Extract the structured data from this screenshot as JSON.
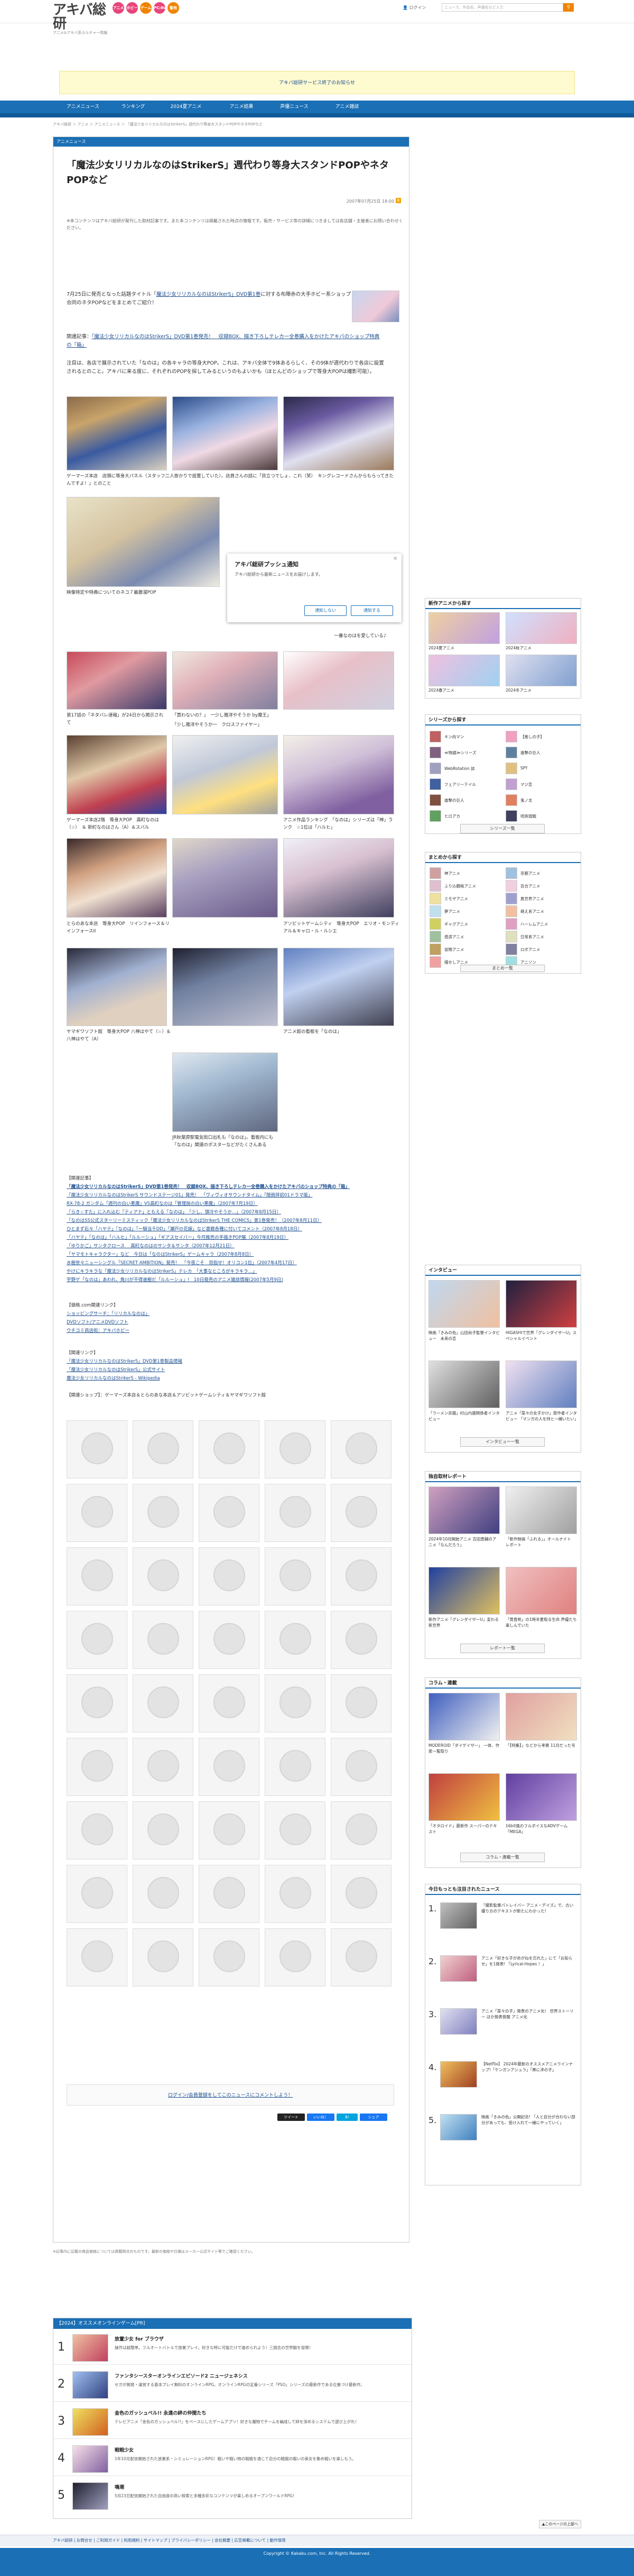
{
  "site": {
    "logo_main": "アキバ総研",
    "logo_sub": "アニメ&アキバ系カルチャー情報",
    "login": "ログイン",
    "search_placeholder": "ニュース、作品名、声優名など入力",
    "search_btn": "🔍"
  },
  "cats": [
    {
      "label": "アニメ",
      "color": "#e8457b"
    },
    {
      "label": "ホビー",
      "color": "#e8457b"
    },
    {
      "label": "ゲーム",
      "color": "#f08300"
    },
    {
      "label": "PC/AV",
      "color": "#e8457b"
    },
    {
      "label": "聖地",
      "color": "#f08300"
    }
  ],
  "notice": "アキバ総研サービス終了のお知らせ",
  "nav": [
    "アニメニュース",
    "ランキング",
    "2024夏アニメ",
    "アニメ結果",
    "声優ニュース",
    "アニメ雑誌"
  ],
  "breadcrumb": "アキバ総研 ＞ アニメ ＞ アニメニュース ＞ 「魔法少女リリカルなのはStrikerS」週代わり等身大スタンドPOPやネタPOPなど",
  "main": {
    "section": "アニメニュース",
    "title": "「魔法少女リリカルなのはStrikerS」週代わり等身大スタンドPOPやネタPOPなど",
    "date": "2007年07月25日 18:00",
    "share": "B",
    "disclaimer": "※本コンテンツはアキバ総研が発刊した取材記事です。また本コンテンツは掲載された時点の情報です。販売・サービス等の詳細につきましては各店舗・主催者にお問い合わせください。",
    "p1a": "7月25日に発売となった話題タイトル「",
    "p1link": "魔法少女リリカルなのはStrikerS」DVD第1巻",
    "p1b": "に対する布陣赤の大手ホビー系ショップ合同のネタPOPなどをまとめてご紹介！",
    "p2a": "関連記事：",
    "p2link": "「魔法少女リリカルなのはStrikerS」DVD第1巻発売！　収録BOX、描き下ろしテレカ一全巻購入をかけたアキバのショップ特典の「箱」",
    "p3": "注目は、各店で展示されていた「なのは」の各キャラの等身大POP。これは、アキバ全体で9体あるらしく、その9体が週代わりで各店に設置されるとのこと。アキバに来る度に、それぞれのPOPを探してみるというのもよいかも（ほとんどのショップで等身大POPは撮影可能）。",
    "cap1": "ゲーマーズ本店　店頭に等身大パネル（スタッフ二人掛かりで設置していた）。店員さんの話に「目立つでしょ、これ（笑）　キングレコードさんからもらってきたんですよ！」とのこと",
    "cap2": "映像特定や特典についてのネコ７最藤溜POP",
    "cap3": "一番なのはを愛している♪",
    "cap4": "第17話の「ネタバレ速報」が24日から掲示されて",
    "cap5": "「買わないの？」　一少し雅洋やそうか by魔王」",
    "cap6": "「少し雅洋やそうか一　クロスファイヤー」",
    "cap7": "ゲーマーズ本店2階　等身大POP　高町なのは（☆）　＆ 新町なのはさん（A）＆スバル",
    "cap8": "アニメ作品ランキング　「なのは」シリーズは「神」ランク　☆1位は「ハルヒ」",
    "cap9": "とらのあな本店　等身大POP　リインフォース＆リインフォースII",
    "cap10": "アソビットゲームシティ　等身大POP　エリオ・モンディアル＆キャロ・ル・ルシエ",
    "cap11": "ヤマギワソフト館　等身大POP 八神はやて（☆）＆八神はやて（A）",
    "cap12": "アニメ館の看板を「なのは」",
    "cap13": "JR秋葉原駅電気街口出札も「なのは」。看板内にも「なのは」関連のポスターなどがたくさんある",
    "popup_title": "アキバ総研プッシュ通知",
    "popup_body": "アキバ総研から最新ニュースをお届けします。",
    "popup_no": "通知しない",
    "popup_yes": "通知する",
    "rel_head": "【関連記事】",
    "rel_links": [
      "「魔法少女リリカルなのはStrikerS」DVD第1巻発売！　収録BOX、描き下ろしテレカ一全巻購入をかけたアキバのショップ特典の「箱」",
      "「魔法少女リリカルなのはStrikerS サウンドステージ01」発売！　「ヴィヴィオサウンドタイム」「隠雨拝初01ドラマ版」",
      "RX-78-2 ガンダム「週刊の白い悪魔」VS高町なのは「管理局の白い悪魔」（2007年7月19日）",
      "「らき☆すた」に入れ込む「ティアナ」ともえる「なのは」　「少し、頭冷やそうか…」（2007年8月15日）",
      "「なのはSS公式スターリーミスティック「魔法少女リリカルなのはStrikerS THE COMICS」第1巻発売！（2007年8月11日）",
      "ひとまず石々「ハヤテ」「なのは」「一騎当千DD」「瀬戸の花嫁」など書籍各種に付いてコメント（2007年8月18日）",
      "「ハヤテ」「なのは」「ハルヒ」「ルルーシュ」「ギアスセイバー」今月推売の手描きPOP展（2007年8月19日）",
      "「ゆりかご」サンタクロース 　高町なのはのサンタ＆サンタ（2007年12月21日）",
      "「ヤマモトキャラクター」など　今日は「なのはStrikerS」ゲームキャラ（2007年8月8日）",
      "水樹奈々ニューシングル「SECRET AMBITION」発売！　「今夜こそ　目指せ！オリコン1位」（2007年4月17日）",
      "やけにキラキラな「魔法少女リリカルなのはStrikerS」テレカ　「大事なところがキラキラ…」",
      "宇野ゲ「なのは」あわれ、角川が不得道樹だ「ルルーシュ」!　10日発売のアニメ雑誌情報(2007年5月9日)"
    ],
    "ecom_head": "【価格.com関連リンク】",
    "ecom_links": [
      "ショッピングサーチ：「リリカルなのは」",
      "DVDソフト/アニメDVDソフト",
      "ウチコミ商店街：アキバホビー"
    ],
    "link_head": "【関連リンク】",
    "links": [
      "「魔法少女リリカルなのはStrikerS」DVD第1巻製品情報",
      "「魔法少女リリカルなのはStrikerS」公式サイト",
      "魔法少女リリカルなのはStrikerS - Wikipedia"
    ],
    "shop_line": "【関連ショップ】：ゲーマーズ本店＆とらのあな本店＆アソビットゲームシティ＆ヤマギワソフト館",
    "comment_link": "ログイン/会員登録をしてこのニュースにコメントしよう！",
    "share_btns": [
      "ツイート",
      "いいね！",
      "B!",
      "シェア"
    ],
    "footer_note": "※記事内に記載の商品価格については掲載時点のものです。最新の価格や仕様はメーカー公式サイト等でご確認ください。"
  },
  "ranking": {
    "header": "【2024】オススメオンラインゲーム[PR]",
    "items": [
      {
        "title": "放置少女 for ブラウザ",
        "desc": "操作は超簡単。フルオートバトルで放置プレイ。好きな時に可能だけで進められよう！三国志の世界観を冒険！"
      },
      {
        "title": "ファンタシースターオンラインエピソード2 ニュージェネシス",
        "desc": "セガが開発・運営する基本プレイ無料のオンラインRPG。オンラインRPGの定番シリーズ「PSO」シリーズの最新作である位置づけ最新作。"
      },
      {
        "title": "金色のガッシュベル!! 永遠の絆の仲間たち",
        "desc": "テレビアニメ「金色のガッシュベル!!」をベースにしたゲームアプリ！好きな魔物でチームを編成して絆を深めるシステムで遊び上がれ！"
      },
      {
        "title": "戦戦少女",
        "desc": "1年10月配信開始された放置系・シミュレーションRPG！戦いや戦い物の戦戦を通じて自分の戦戦の戦いの美女を集め戦いを楽しもう。"
      },
      {
        "title": "鳴潮",
        "desc": "5月23日配信開始された自由度の高い探索と多種多彩なコンテンツが楽しめるオープンワールドRPG！"
      }
    ]
  },
  "side": {
    "new_head": "新作アニメから探す",
    "new_items": [
      "2024夏アニメ",
      "2024秋アニメ",
      "2024春アニメ",
      "2024冬アニメ"
    ],
    "series_head": "シリーズから探す",
    "series": [
      "キン肉マン",
      "【推しの子】",
      "≪物語≫シリーズ",
      "進撃の巨人",
      "WebRotation 誌",
      "SPY",
      "フェアリーテイル",
      "マジ恋",
      "進撃の巨人",
      "鬼ノ太",
      "ヒロアカ",
      "呪術廻戦"
    ],
    "series_more": "シリーズ一覧",
    "matome_head": "まとめから探す",
    "matome": [
      "神アニメ",
      "京都アニメ",
      "ふり込額格アニメ",
      "百合アニメ",
      "ミモザアニメ",
      "異世界アニメ",
      "夢アニメ",
      "萌え系アニメ",
      "ギャグアニメ",
      "ハーレムアニメ",
      "感涙アニメ",
      "日常系アニメ",
      "冒険アニメ",
      "ロボアニメ",
      "描せしアニメ",
      "アニソン"
    ],
    "matome_more": "まとめ一覧",
    "interview_head": "インタビュー",
    "interview": [
      "映画「きみの色」山田尚子監督インタビュー　未来の恋",
      "HIGASHIで世界「グレンダイザーU」スペシャルイベント",
      "「ラーメン赤猫」村山内盛関係者インタビュー",
      "アニメ「菜々の女子かけ」原作者インタビュー 「マンガの人を持と一緒いたい」"
    ],
    "interview_more": "インタビュー一覧",
    "report_head": "独自取材レポート",
    "report": [
      "2024年10月開始アニメ 吉田恵輔のアニメ「なんだろう」",
      "「新作映画「ふれる」」オールナイト　レポート",
      "新作アニメ「グレンダイザーU」変わる新世界",
      "「黄昏帆」の1時半夏取る生命 声優たち楽しんでいた"
    ],
    "report_more": "レポート一覧",
    "column_head": "コラム・連載",
    "column": [
      "MODEROID「ダイゲイザー」 一体、作家一覧取り",
      "「【特集】」などから考察 11月だった号",
      "「オタロイド」最新作 スーパーのテキスト",
      "16bit風のフルボイスなADVゲーム「MEGA」"
    ],
    "column_more": "コラム・連載一覧",
    "popular_head": "今日もっとも注目されたニュース",
    "popular": [
      "「撮影監督パトレイバー アニメ・デイズ」で、古い撮り方のテキストが新たにわかった!",
      "アニメ「好きな子がめがねを忘れた」にて「お知らせ」を1発表! 「Lyrical-Hopes ！」",
      "アニメ「菜々の子」発表のアニメ化！ 世界ストーリー ほか発表情報 アニメ化",
      "【Netflix】 2024年最新のオススメアニメラインナップ!「ケンガンアシュラ」「黒に滲の子」",
      "映画「きみの色」公開記念! 「人と自分が合わない部分があっても、受け入れて一緒にやっていく」"
    ]
  },
  "footer": {
    "pagetop": "▲このページの上部へ",
    "links": "アキバ総研 | お問合せ | ご利用ガイド | 利用規約 | サイトマップ | プライバシーポリシー | 会社概要 | 広告掲載について | 動作環境",
    "copy": "Copyright © Kakaku.com, Inc. All Rights Reserved."
  }
}
